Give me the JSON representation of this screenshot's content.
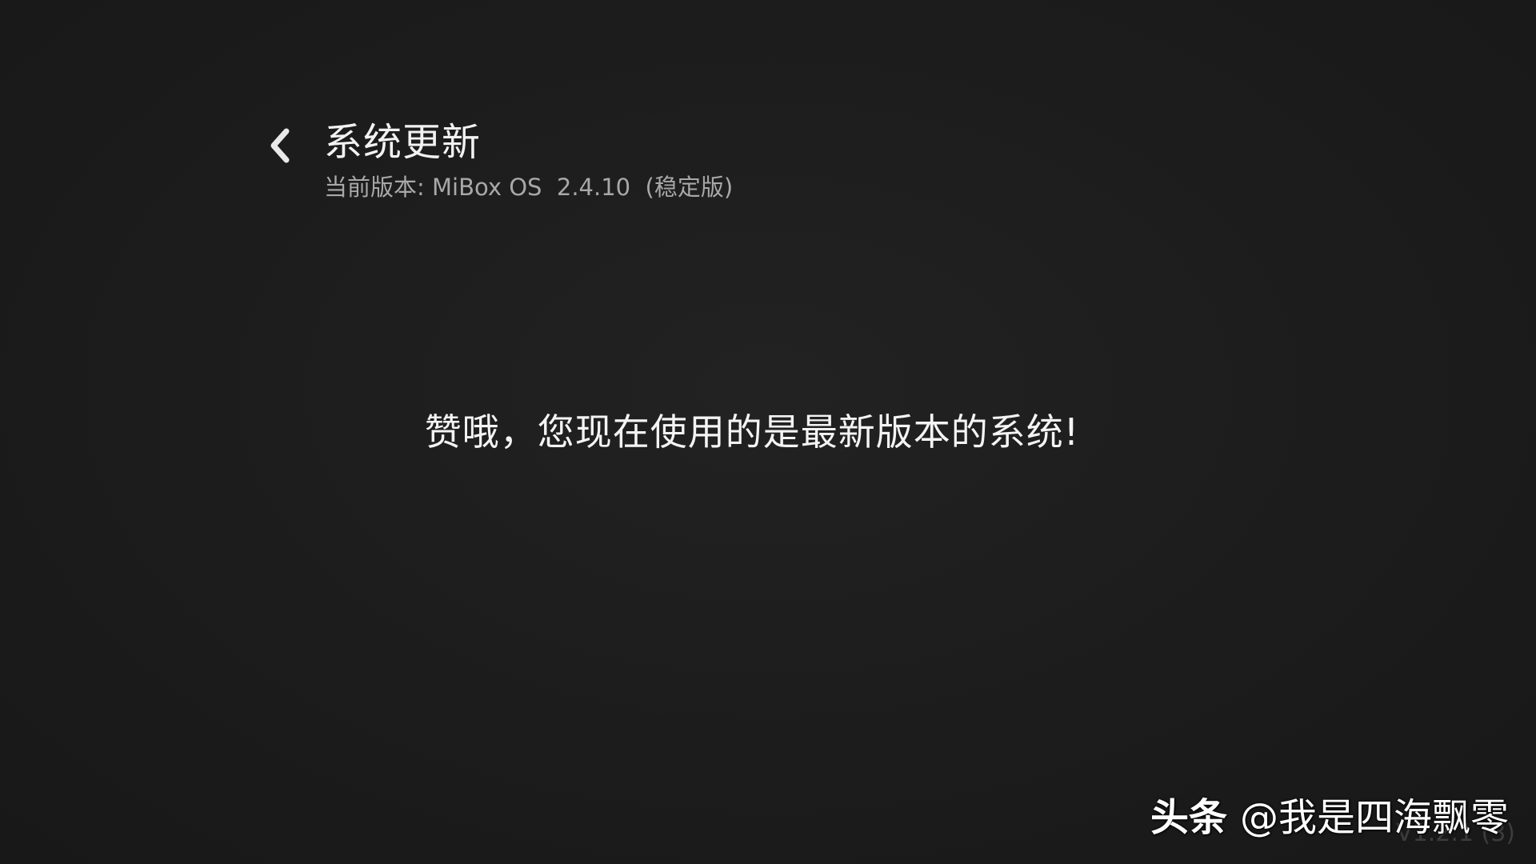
{
  "header": {
    "back_icon": "chevron-left-icon",
    "title": "系统更新",
    "current_version": "当前版本: MiBox OS  2.4.10  (稳定版)"
  },
  "main": {
    "status_message": "赞哦，您现在使用的是最新版本的系统!"
  },
  "footer": {
    "app_version": "V1.2.1 (3)",
    "watermark_brand": "头条",
    "watermark_handle": "@我是四海飘零"
  },
  "colors": {
    "background": "#1b1b1b",
    "title_text": "#f2f2f2",
    "subtitle_text": "#a8a8a8",
    "message_text": "#f4f4f4",
    "version_text": "#3c3c3c"
  }
}
